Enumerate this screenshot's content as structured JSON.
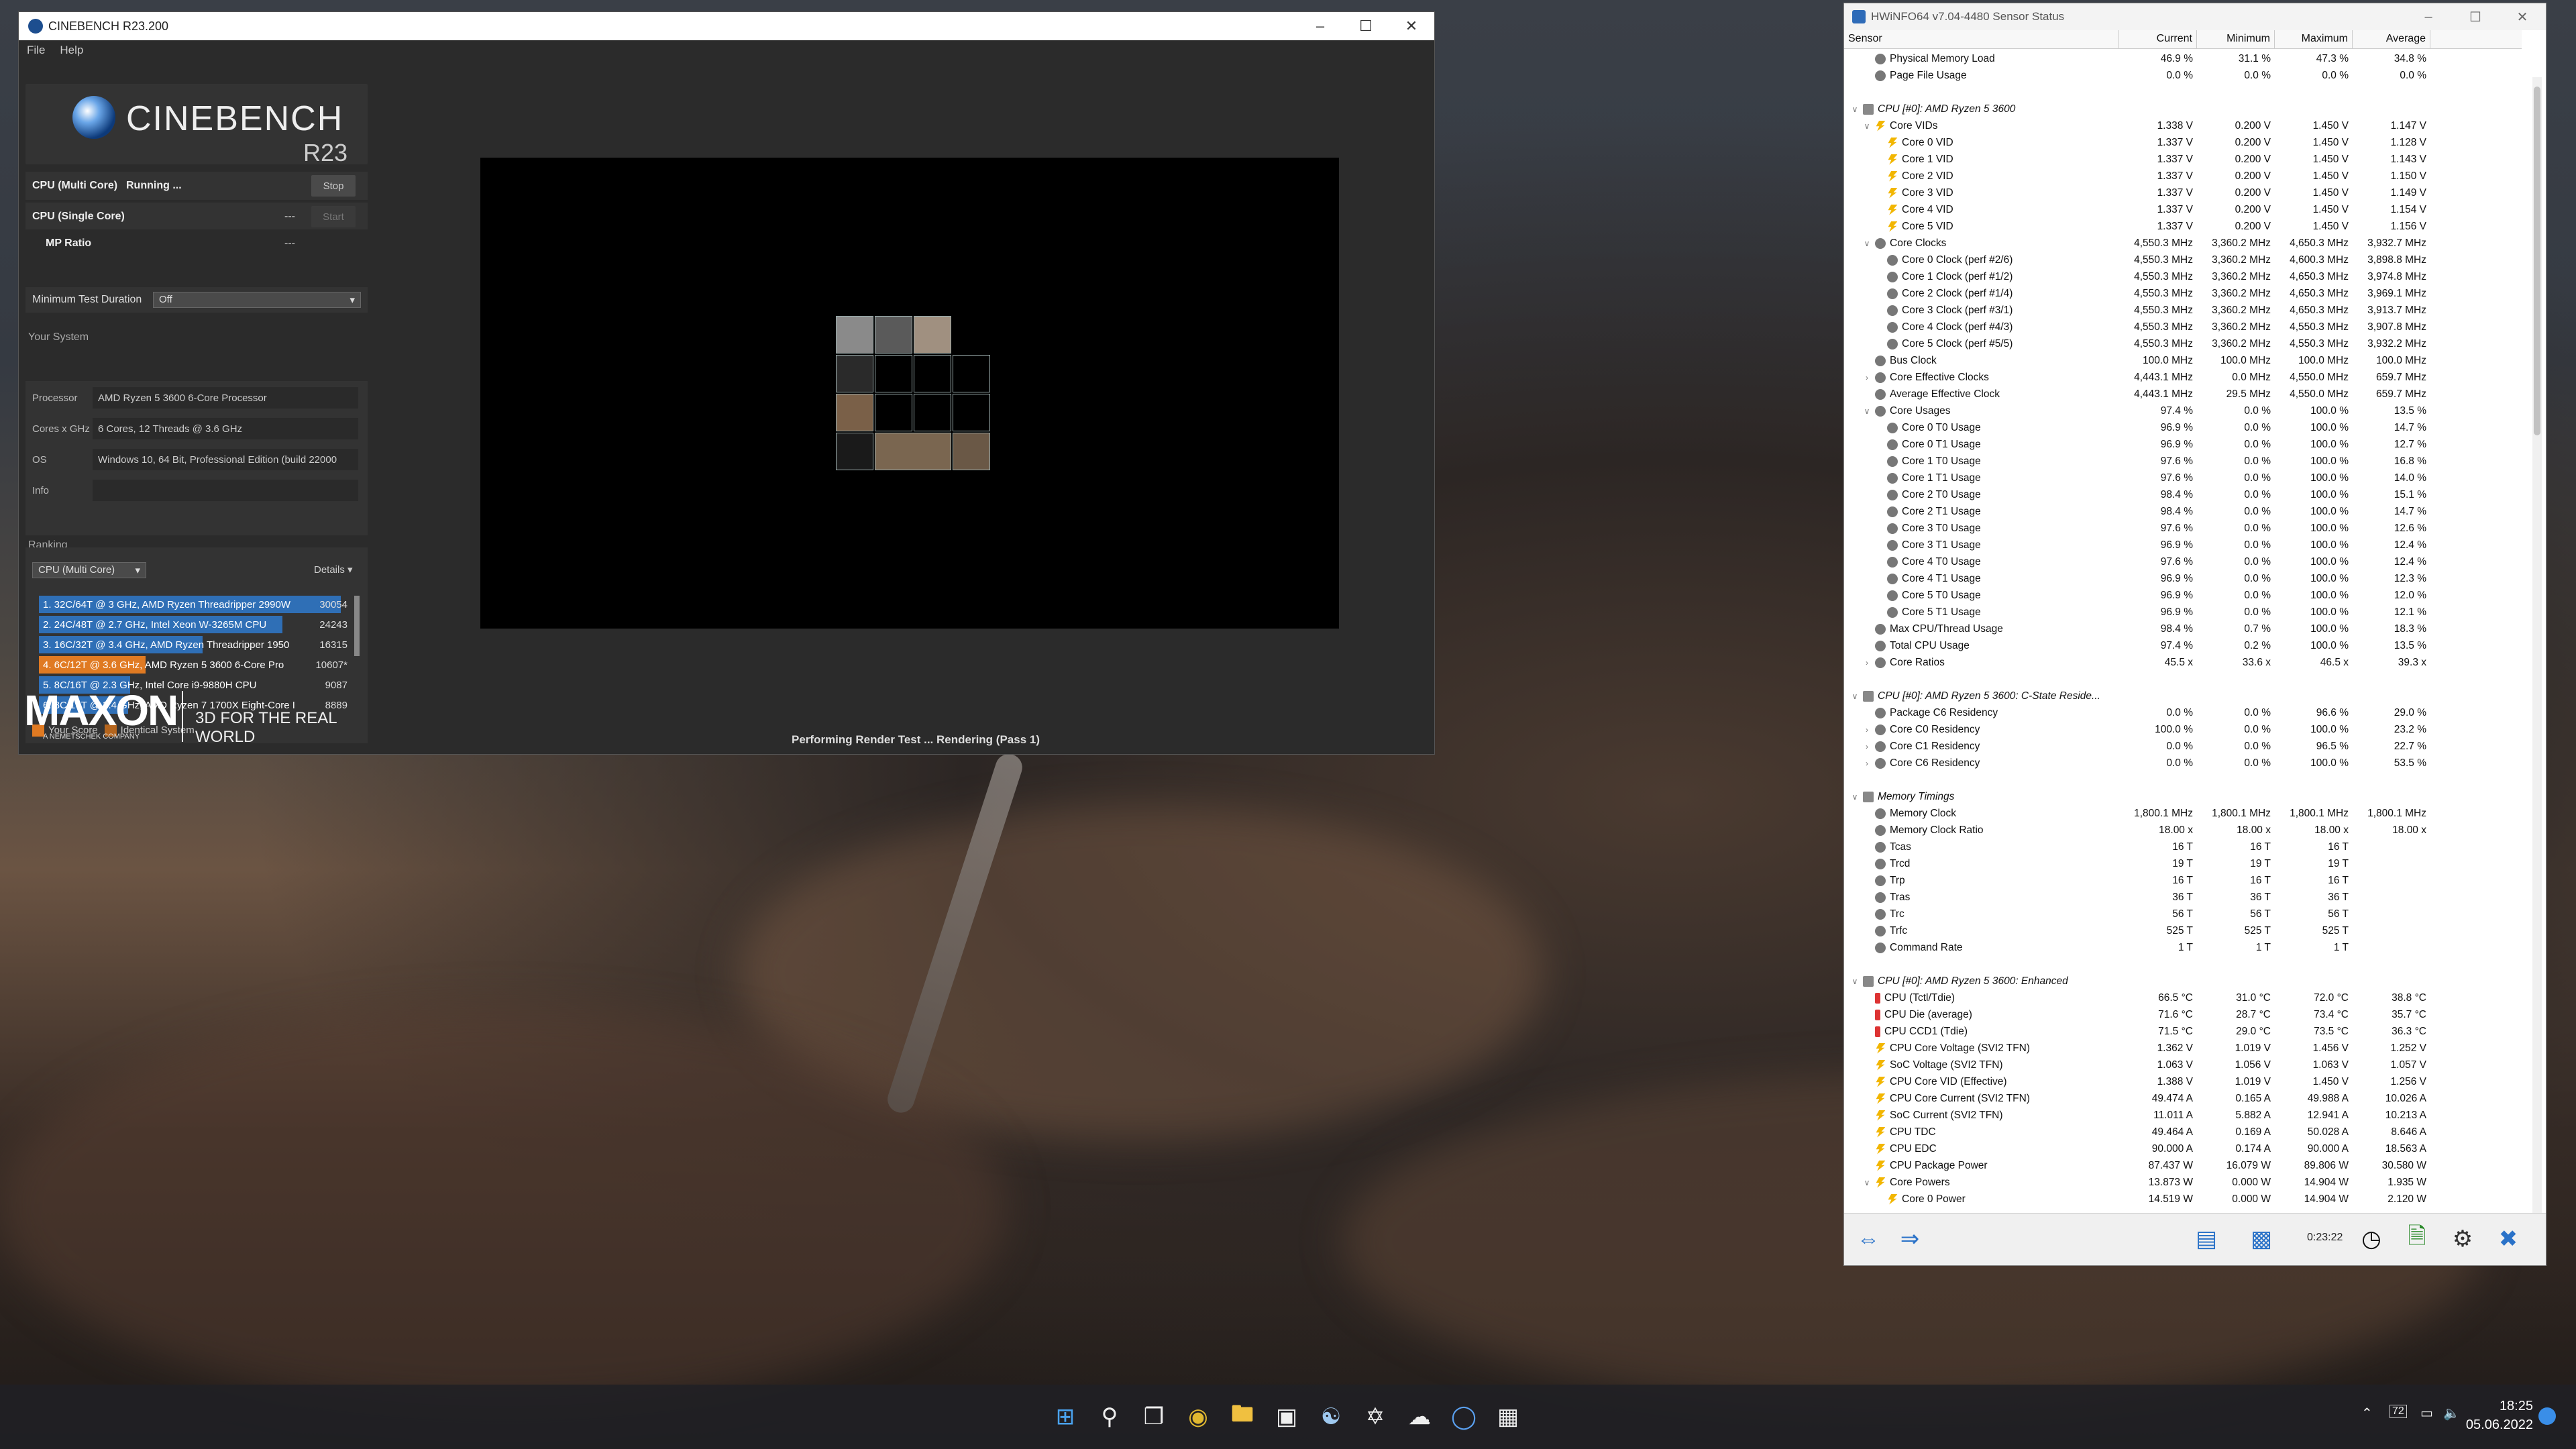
{
  "cinebench": {
    "title": "CINEBENCH R23.200",
    "menu": [
      "File",
      "Help"
    ],
    "logo_name": "CINEBENCH",
    "logo_version": "R23",
    "tests": [
      {
        "label": "CPU (Multi Core)",
        "status": "Running ...",
        "value": "",
        "button": "Stop"
      },
      {
        "label": "CPU (Single Core)",
        "status": "",
        "value": "---",
        "button": "Start"
      },
      {
        "label": "MP Ratio",
        "status": "",
        "value": "---",
        "button": ""
      }
    ],
    "min_test_duration_label": "Minimum Test Duration",
    "min_test_duration_value": "Off",
    "your_system_label": "Your System",
    "system": [
      {
        "k": "Processor",
        "v": "AMD Ryzen 5 3600 6-Core Processor"
      },
      {
        "k": "Cores x GHz",
        "v": "6 Cores, 12 Threads @ 3.6 GHz"
      },
      {
        "k": "OS",
        "v": "Windows 10, 64 Bit, Professional Edition (build 22000"
      },
      {
        "k": "Info",
        "v": ""
      }
    ],
    "ranking_label": "Ranking",
    "ranking_select": "CPU (Multi Core)",
    "details_label": "Details",
    "ranking": [
      {
        "text": "1. 32C/64T @ 3 GHz, AMD Ryzen Threadripper 2990W",
        "score": "30054",
        "fill": 1.0,
        "color": "#2f6fb6"
      },
      {
        "text": "2. 24C/48T @ 2.7 GHz, Intel Xeon W-3265M CPU",
        "score": "24243",
        "fill": 0.807,
        "color": "#2f6fb6"
      },
      {
        "text": "3. 16C/32T @ 3.4 GHz, AMD Ryzen Threadripper 1950",
        "score": "16315",
        "fill": 0.543,
        "color": "#2f6fb6"
      },
      {
        "text": "4. 6C/12T @ 3.6 GHz, AMD Ryzen 5 3600 6-Core Pro",
        "score": "10607*",
        "fill": 0.353,
        "color": "#e07a22"
      },
      {
        "text": "5. 8C/16T @ 2.3 GHz, Intel Core i9-9880H CPU",
        "score": "9087",
        "fill": 0.302,
        "color": "#2f6fb6"
      },
      {
        "text": "6. 8C/16T @ 3.4 GHz, AMD Ryzen 7 1700X Eight-Core I",
        "score": "8889",
        "fill": 0.296,
        "color": "#2f6fb6"
      }
    ],
    "legend_your": "Your Score",
    "legend_identical": "Identical System",
    "maxon": "MAXON",
    "maxon_sub": "A NEMETSCHEK COMPANY",
    "tagline": "3D FOR THE REAL WORLD",
    "status": "Performing Render Test ... Rendering (Pass 1)"
  },
  "hwinfo": {
    "title": "HWiNFO64 v7.04-4480 Sensor Status",
    "columns": [
      "Sensor",
      "Current",
      "Minimum",
      "Maximum",
      "Average"
    ],
    "rows": [
      {
        "n": "Physical Memory Load",
        "c": "46.9 %",
        "mi": "31.1 %",
        "ma": "47.3 %",
        "a": "34.8 %",
        "i": "o",
        "d": 1
      },
      {
        "n": "Page File Usage",
        "c": "0.0 %",
        "mi": "0.0 %",
        "ma": "0.0 %",
        "a": "0.0 %",
        "i": "o",
        "d": 1
      },
      {
        "n": "",
        "c": "",
        "mi": "",
        "ma": "",
        "a": "",
        "i": "",
        "d": 0
      },
      {
        "n": "CPU [#0]: AMD Ryzen 5 3600",
        "c": "",
        "mi": "",
        "ma": "",
        "a": "",
        "i": "chip",
        "d": 0,
        "g": 1
      },
      {
        "n": "Core VIDs",
        "c": "1.338 V",
        "mi": "0.200 V",
        "ma": "1.450 V",
        "a": "1.147 V",
        "i": "v",
        "d": 1,
        "e": "v"
      },
      {
        "n": "Core 0 VID",
        "c": "1.337 V",
        "mi": "0.200 V",
        "ma": "1.450 V",
        "a": "1.128 V",
        "i": "v",
        "d": 2
      },
      {
        "n": "Core 1 VID",
        "c": "1.337 V",
        "mi": "0.200 V",
        "ma": "1.450 V",
        "a": "1.143 V",
        "i": "v",
        "d": 2
      },
      {
        "n": "Core 2 VID",
        "c": "1.337 V",
        "mi": "0.200 V",
        "ma": "1.450 V",
        "a": "1.150 V",
        "i": "v",
        "d": 2
      },
      {
        "n": "Core 3 VID",
        "c": "1.337 V",
        "mi": "0.200 V",
        "ma": "1.450 V",
        "a": "1.149 V",
        "i": "v",
        "d": 2
      },
      {
        "n": "Core 4 VID",
        "c": "1.337 V",
        "mi": "0.200 V",
        "ma": "1.450 V",
        "a": "1.154 V",
        "i": "v",
        "d": 2
      },
      {
        "n": "Core 5 VID",
        "c": "1.337 V",
        "mi": "0.200 V",
        "ma": "1.450 V",
        "a": "1.156 V",
        "i": "v",
        "d": 2
      },
      {
        "n": "Core Clocks",
        "c": "4,550.3 MHz",
        "mi": "3,360.2 MHz",
        "ma": "4,650.3 MHz",
        "a": "3,932.7 MHz",
        "i": "o",
        "d": 1,
        "e": "v"
      },
      {
        "n": "Core 0 Clock (perf #2/6)",
        "c": "4,550.3 MHz",
        "mi": "3,360.2 MHz",
        "ma": "4,600.3 MHz",
        "a": "3,898.8 MHz",
        "i": "o",
        "d": 2
      },
      {
        "n": "Core 1 Clock (perf #1/2)",
        "c": "4,550.3 MHz",
        "mi": "3,360.2 MHz",
        "ma": "4,650.3 MHz",
        "a": "3,974.8 MHz",
        "i": "o",
        "d": 2
      },
      {
        "n": "Core 2 Clock (perf #1/4)",
        "c": "4,550.3 MHz",
        "mi": "3,360.2 MHz",
        "ma": "4,650.3 MHz",
        "a": "3,969.1 MHz",
        "i": "o",
        "d": 2
      },
      {
        "n": "Core 3 Clock (perf #3/1)",
        "c": "4,550.3 MHz",
        "mi": "3,360.2 MHz",
        "ma": "4,650.3 MHz",
        "a": "3,913.7 MHz",
        "i": "o",
        "d": 2
      },
      {
        "n": "Core 4 Clock (perf #4/3)",
        "c": "4,550.3 MHz",
        "mi": "3,360.2 MHz",
        "ma": "4,550.3 MHz",
        "a": "3,907.8 MHz",
        "i": "o",
        "d": 2
      },
      {
        "n": "Core 5 Clock (perf #5/5)",
        "c": "4,550.3 MHz",
        "mi": "3,360.2 MHz",
        "ma": "4,550.3 MHz",
        "a": "3,932.2 MHz",
        "i": "o",
        "d": 2
      },
      {
        "n": "Bus Clock",
        "c": "100.0 MHz",
        "mi": "100.0 MHz",
        "ma": "100.0 MHz",
        "a": "100.0 MHz",
        "i": "o",
        "d": 1
      },
      {
        "n": "Core Effective Clocks",
        "c": "4,443.1 MHz",
        "mi": "0.0 MHz",
        "ma": "4,550.0 MHz",
        "a": "659.7 MHz",
        "i": "o",
        "d": 1,
        "e": ">"
      },
      {
        "n": "Average Effective Clock",
        "c": "4,443.1 MHz",
        "mi": "29.5 MHz",
        "ma": "4,550.0 MHz",
        "a": "659.7 MHz",
        "i": "o",
        "d": 1
      },
      {
        "n": "Core Usages",
        "c": "97.4 %",
        "mi": "0.0 %",
        "ma": "100.0 %",
        "a": "13.5 %",
        "i": "o",
        "d": 1,
        "e": "v"
      },
      {
        "n": "Core 0 T0 Usage",
        "c": "96.9 %",
        "mi": "0.0 %",
        "ma": "100.0 %",
        "a": "14.7 %",
        "i": "o",
        "d": 2
      },
      {
        "n": "Core 0 T1 Usage",
        "c": "96.9 %",
        "mi": "0.0 %",
        "ma": "100.0 %",
        "a": "12.7 %",
        "i": "o",
        "d": 2
      },
      {
        "n": "Core 1 T0 Usage",
        "c": "97.6 %",
        "mi": "0.0 %",
        "ma": "100.0 %",
        "a": "16.8 %",
        "i": "o",
        "d": 2
      },
      {
        "n": "Core 1 T1 Usage",
        "c": "97.6 %",
        "mi": "0.0 %",
        "ma": "100.0 %",
        "a": "14.0 %",
        "i": "o",
        "d": 2
      },
      {
        "n": "Core 2 T0 Usage",
        "c": "98.4 %",
        "mi": "0.0 %",
        "ma": "100.0 %",
        "a": "15.1 %",
        "i": "o",
        "d": 2
      },
      {
        "n": "Core 2 T1 Usage",
        "c": "98.4 %",
        "mi": "0.0 %",
        "ma": "100.0 %",
        "a": "14.7 %",
        "i": "o",
        "d": 2
      },
      {
        "n": "Core 3 T0 Usage",
        "c": "97.6 %",
        "mi": "0.0 %",
        "ma": "100.0 %",
        "a": "12.6 %",
        "i": "o",
        "d": 2
      },
      {
        "n": "Core 3 T1 Usage",
        "c": "96.9 %",
        "mi": "0.0 %",
        "ma": "100.0 %",
        "a": "12.4 %",
        "i": "o",
        "d": 2
      },
      {
        "n": "Core 4 T0 Usage",
        "c": "97.6 %",
        "mi": "0.0 %",
        "ma": "100.0 %",
        "a": "12.4 %",
        "i": "o",
        "d": 2
      },
      {
        "n": "Core 4 T1 Usage",
        "c": "96.9 %",
        "mi": "0.0 %",
        "ma": "100.0 %",
        "a": "12.3 %",
        "i": "o",
        "d": 2
      },
      {
        "n": "Core 5 T0 Usage",
        "c": "96.9 %",
        "mi": "0.0 %",
        "ma": "100.0 %",
        "a": "12.0 %",
        "i": "o",
        "d": 2
      },
      {
        "n": "Core 5 T1 Usage",
        "c": "96.9 %",
        "mi": "0.0 %",
        "ma": "100.0 %",
        "a": "12.1 %",
        "i": "o",
        "d": 2
      },
      {
        "n": "Max CPU/Thread Usage",
        "c": "98.4 %",
        "mi": "0.7 %",
        "ma": "100.0 %",
        "a": "18.3 %",
        "i": "o",
        "d": 1
      },
      {
        "n": "Total CPU Usage",
        "c": "97.4 %",
        "mi": "0.2 %",
        "ma": "100.0 %",
        "a": "13.5 %",
        "i": "o",
        "d": 1
      },
      {
        "n": "Core Ratios",
        "c": "45.5 x",
        "mi": "33.6 x",
        "ma": "46.5 x",
        "a": "39.3 x",
        "i": "o",
        "d": 1,
        "e": ">"
      },
      {
        "n": "",
        "c": "",
        "mi": "",
        "ma": "",
        "a": "",
        "i": "",
        "d": 0
      },
      {
        "n": "CPU [#0]: AMD Ryzen 5 3600: C-State Reside...",
        "c": "",
        "mi": "",
        "ma": "",
        "a": "",
        "i": "chip",
        "d": 0,
        "g": 1
      },
      {
        "n": "Package C6 Residency",
        "c": "0.0 %",
        "mi": "0.0 %",
        "ma": "96.6 %",
        "a": "29.0 %",
        "i": "o",
        "d": 1
      },
      {
        "n": "Core C0 Residency",
        "c": "100.0 %",
        "mi": "0.0 %",
        "ma": "100.0 %",
        "a": "23.2 %",
        "i": "o",
        "d": 1,
        "e": ">"
      },
      {
        "n": "Core C1 Residency",
        "c": "0.0 %",
        "mi": "0.0 %",
        "ma": "96.5 %",
        "a": "22.7 %",
        "i": "o",
        "d": 1,
        "e": ">"
      },
      {
        "n": "Core C6 Residency",
        "c": "0.0 %",
        "mi": "0.0 %",
        "ma": "100.0 %",
        "a": "53.5 %",
        "i": "o",
        "d": 1,
        "e": ">"
      },
      {
        "n": "",
        "c": "",
        "mi": "",
        "ma": "",
        "a": "",
        "i": "",
        "d": 0
      },
      {
        "n": "Memory Timings",
        "c": "",
        "mi": "",
        "ma": "",
        "a": "",
        "i": "chip",
        "d": 0,
        "g": 1
      },
      {
        "n": "Memory Clock",
        "c": "1,800.1 MHz",
        "mi": "1,800.1 MHz",
        "ma": "1,800.1 MHz",
        "a": "1,800.1 MHz",
        "i": "o",
        "d": 1
      },
      {
        "n": "Memory Clock Ratio",
        "c": "18.00 x",
        "mi": "18.00 x",
        "ma": "18.00 x",
        "a": "18.00 x",
        "i": "o",
        "d": 1
      },
      {
        "n": "Tcas",
        "c": "16 T",
        "mi": "16 T",
        "ma": "16 T",
        "a": "",
        "i": "o",
        "d": 1
      },
      {
        "n": "Trcd",
        "c": "19 T",
        "mi": "19 T",
        "ma": "19 T",
        "a": "",
        "i": "o",
        "d": 1
      },
      {
        "n": "Trp",
        "c": "16 T",
        "mi": "16 T",
        "ma": "16 T",
        "a": "",
        "i": "o",
        "d": 1
      },
      {
        "n": "Tras",
        "c": "36 T",
        "mi": "36 T",
        "ma": "36 T",
        "a": "",
        "i": "o",
        "d": 1
      },
      {
        "n": "Trc",
        "c": "56 T",
        "mi": "56 T",
        "ma": "56 T",
        "a": "",
        "i": "o",
        "d": 1
      },
      {
        "n": "Trfc",
        "c": "525 T",
        "mi": "525 T",
        "ma": "525 T",
        "a": "",
        "i": "o",
        "d": 1
      },
      {
        "n": "Command Rate",
        "c": "1 T",
        "mi": "1 T",
        "ma": "1 T",
        "a": "",
        "i": "o",
        "d": 1
      },
      {
        "n": "",
        "c": "",
        "mi": "",
        "ma": "",
        "a": "",
        "i": "",
        "d": 0
      },
      {
        "n": "CPU [#0]: AMD Ryzen 5 3600: Enhanced",
        "c": "",
        "mi": "",
        "ma": "",
        "a": "",
        "i": "chip",
        "d": 0,
        "g": 1
      },
      {
        "n": "CPU (Tctl/Tdie)",
        "c": "66.5 °C",
        "mi": "31.0 °C",
        "ma": "72.0 °C",
        "a": "38.8 °C",
        "i": "t",
        "d": 1
      },
      {
        "n": "CPU Die (average)",
        "c": "71.6 °C",
        "mi": "28.7 °C",
        "ma": "73.4 °C",
        "a": "35.7 °C",
        "i": "t",
        "d": 1
      },
      {
        "n": "CPU CCD1 (Tdie)",
        "c": "71.5 °C",
        "mi": "29.0 °C",
        "ma": "73.5 °C",
        "a": "36.3 °C",
        "i": "t",
        "d": 1
      },
      {
        "n": "CPU Core Voltage (SVI2 TFN)",
        "c": "1.362 V",
        "mi": "1.019 V",
        "ma": "1.456 V",
        "a": "1.252 V",
        "i": "v",
        "d": 1
      },
      {
        "n": "SoC Voltage (SVI2 TFN)",
        "c": "1.063 V",
        "mi": "1.056 V",
        "ma": "1.063 V",
        "a": "1.057 V",
        "i": "v",
        "d": 1
      },
      {
        "n": "CPU Core VID (Effective)",
        "c": "1.388 V",
        "mi": "1.019 V",
        "ma": "1.450 V",
        "a": "1.256 V",
        "i": "v",
        "d": 1
      },
      {
        "n": "CPU Core Current (SVI2 TFN)",
        "c": "49.474 A",
        "mi": "0.165 A",
        "ma": "49.988 A",
        "a": "10.026 A",
        "i": "v",
        "d": 1
      },
      {
        "n": "SoC Current (SVI2 TFN)",
        "c": "11.011 A",
        "mi": "5.882 A",
        "ma": "12.941 A",
        "a": "10.213 A",
        "i": "v",
        "d": 1
      },
      {
        "n": "CPU TDC",
        "c": "49.464 A",
        "mi": "0.169 A",
        "ma": "50.028 A",
        "a": "8.646 A",
        "i": "v",
        "d": 1
      },
      {
        "n": "CPU EDC",
        "c": "90.000 A",
        "mi": "0.174 A",
        "ma": "90.000 A",
        "a": "18.563 A",
        "i": "v",
        "d": 1
      },
      {
        "n": "CPU Package Power",
        "c": "87.437 W",
        "mi": "16.079 W",
        "ma": "89.806 W",
        "a": "30.580 W",
        "i": "v",
        "d": 1
      },
      {
        "n": "Core Powers",
        "c": "13.873 W",
        "mi": "0.000 W",
        "ma": "14.904 W",
        "a": "1.935 W",
        "i": "v",
        "d": 1,
        "e": "v"
      },
      {
        "n": "Core 0 Power",
        "c": "14.519 W",
        "mi": "0.000 W",
        "ma": "14.904 W",
        "a": "2.120 W",
        "i": "v",
        "d": 2
      }
    ],
    "timer": "0:23:22"
  },
  "taskbar": {
    "clock_time": "18:25",
    "clock_date": "05.06.2022",
    "tray_num": "72"
  }
}
